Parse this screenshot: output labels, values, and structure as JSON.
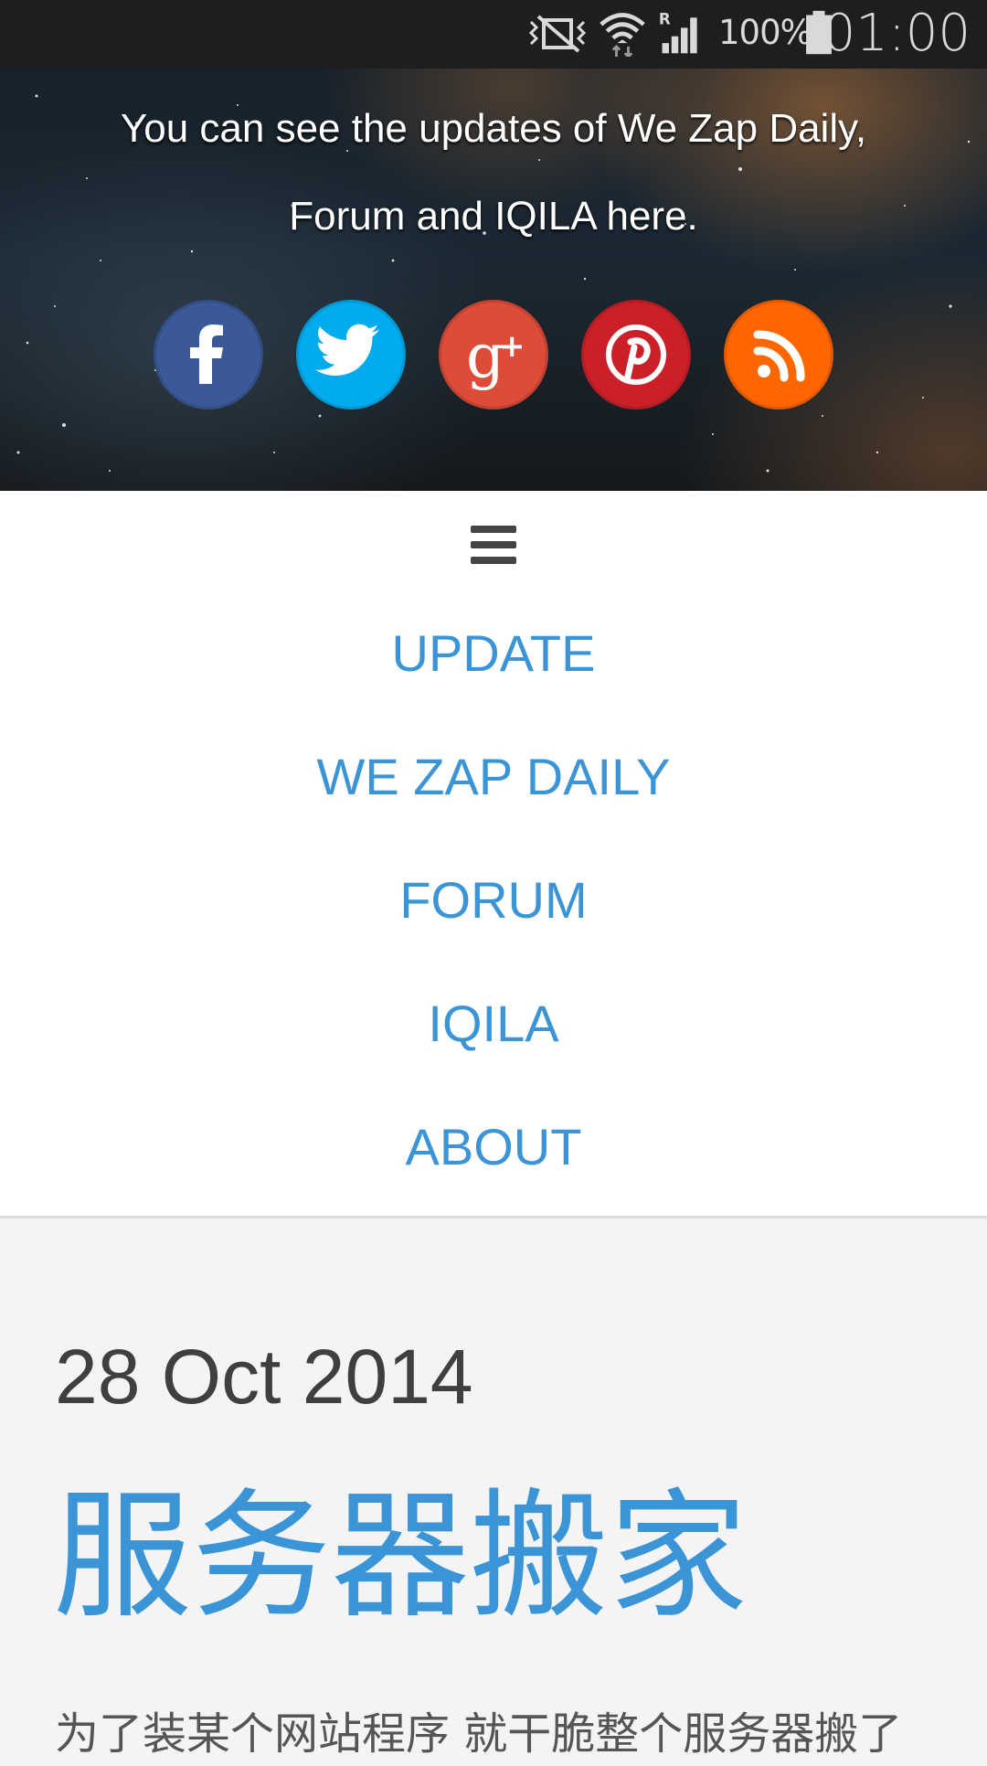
{
  "status_bar": {
    "battery_percent": "100%",
    "time": "01:00",
    "icons": [
      "vibrate-mute-icon",
      "wifi-icon",
      "roaming-signal-icon",
      "battery-icon"
    ]
  },
  "hero": {
    "line1": "You can see the updates of We Zap Daily,",
    "line2": "Forum and IQILA here.",
    "social": [
      {
        "name": "facebook-icon",
        "color": "#3b5998"
      },
      {
        "name": "twitter-icon",
        "color": "#00aced"
      },
      {
        "name": "google-plus-icon",
        "color": "#dd4b39"
      },
      {
        "name": "pinterest-icon",
        "color": "#cb2027"
      },
      {
        "name": "rss-icon",
        "color": "#ff6600"
      }
    ]
  },
  "nav": {
    "menu_icon": "hamburger-menu-icon",
    "items": [
      "UPDATE",
      "WE ZAP DAILY",
      "FORUM",
      "IQILA",
      "ABOUT"
    ]
  },
  "post": {
    "date": "28 Oct 2014",
    "title": "服务器搬家",
    "excerpt": "为了装某个网站程序 就干脆整个服务器搬了"
  },
  "colors": {
    "accent": "#3a94d6",
    "status_bar": "#1e1e1e",
    "page_bg": "#f4f4f4"
  }
}
